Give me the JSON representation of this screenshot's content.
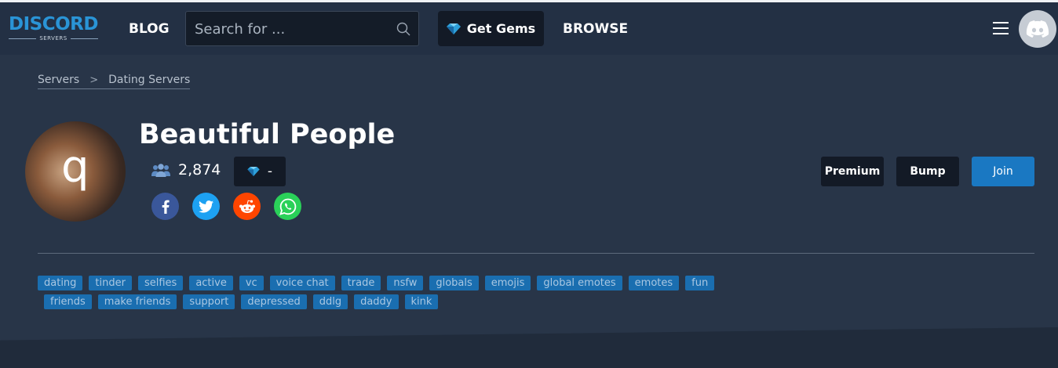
{
  "brand": {
    "word": "DISCORD",
    "sub": "SERVERS",
    "color": "#2a94d6"
  },
  "nav": {
    "blog": "BLOG",
    "search_placeholder": "Search for ...",
    "gems": "Get Gems",
    "browse": "BROWSE"
  },
  "breadcrumb": {
    "items": [
      "Servers",
      "Dating Servers"
    ],
    "separator": ">"
  },
  "server": {
    "name": "Beautiful People",
    "avatar_letter": "q",
    "members": "2,874",
    "gems": "-"
  },
  "actions": {
    "premium": "Premium",
    "bump": "Bump",
    "join": "Join"
  },
  "social_icons": [
    "facebook-icon",
    "twitter-icon",
    "reddit-icon",
    "whatsapp-icon"
  ],
  "tags": {
    "row1": [
      "dating",
      "tinder",
      "selfies",
      "active",
      "vc",
      "voice chat",
      "trade",
      "nsfw",
      "globals",
      "emojis",
      "global emotes",
      "emotes",
      "fun"
    ],
    "row2": [
      "friends",
      "make friends",
      "support",
      "depressed",
      "ddlg",
      "daddy",
      "kink"
    ]
  },
  "colors": {
    "join": "#1a78c2",
    "tag": "#1a6eb0",
    "background": "#283548"
  }
}
